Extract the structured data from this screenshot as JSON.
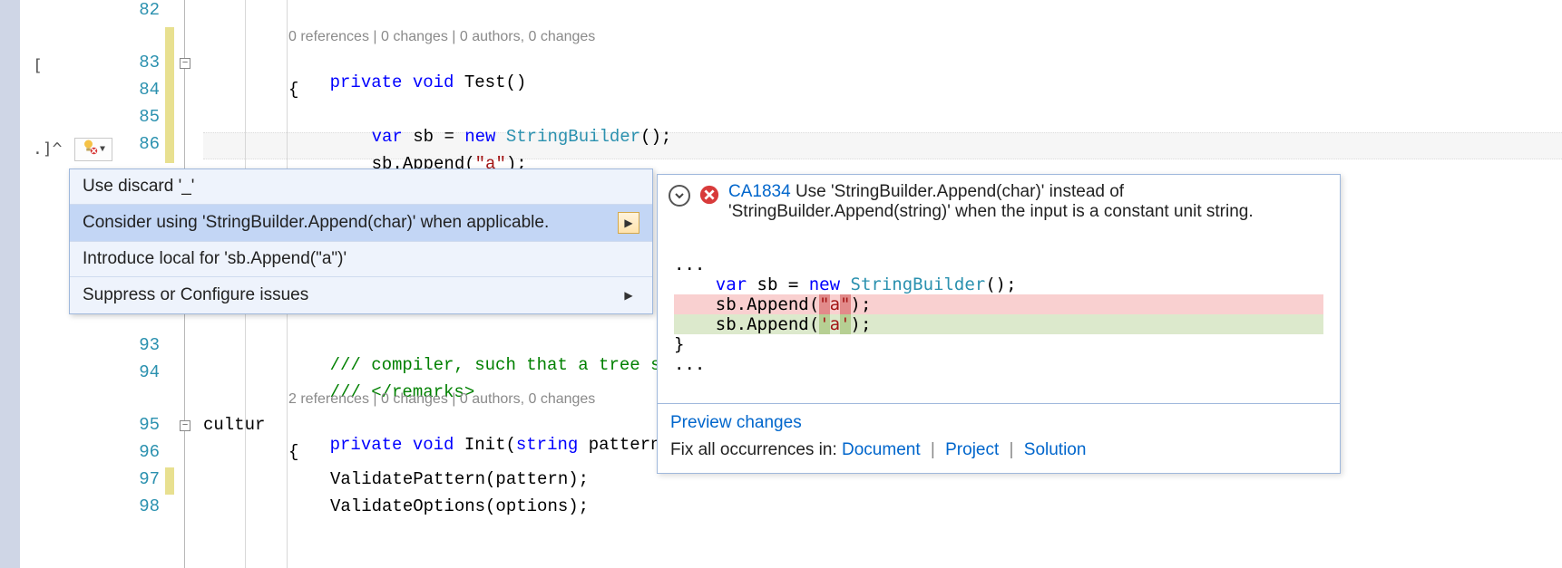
{
  "gutter": {
    "bracket_top": "[",
    "bracket_bottom": ".]^"
  },
  "line_numbers": [
    "82",
    "83",
    "84",
    "85",
    "86",
    "93",
    "94",
    "95",
    "96",
    "97",
    "98"
  ],
  "codelens1": "0 references | 0 changes | 0 authors, 0 changes",
  "codelens2": "2 references | 0 changes | 0 authors, 0 changes",
  "code": {
    "l83_a": "private",
    "l83_b": "void",
    "l83_c": "Test()",
    "l84": "{",
    "l85_a": "var",
    "l85_b": "sb = ",
    "l85_c": "new",
    "l85_d": "StringBuilder",
    "l85_e": "();",
    "l86_a": "sb.Append(",
    "l86_b": "\"a\"",
    "l86_c": ");",
    "l93_a": "/// ",
    "l93_b": "compiler, such that a tree s",
    "l94_a": "/// ",
    "l94_b": "</remarks>",
    "l95_a": "private",
    "l95_b": "void",
    "l95_c": "Init(",
    "l95_d": "string",
    "l95_e": " pattern",
    "l95_tail": "cultur",
    "l96": "{",
    "l97": "ValidatePattern(pattern);",
    "l98": "ValidateOptions(options);"
  },
  "menu": {
    "item1": "Use discard '_'",
    "item2": "Consider using 'StringBuilder.Append(char)' when applicable.",
    "item3": "Introduce local for 'sb.Append(\"a\")'",
    "item4": "Suppress or Configure issues"
  },
  "preview": {
    "rule_id": "CA1834",
    "rule_desc": "Use 'StringBuilder.Append(char)' instead of 'StringBuilder.Append(string)' when the input is a constant unit string.",
    "ellipsis": "...",
    "line_var_a": "var",
    "line_var_b": " sb = ",
    "line_var_c": "new",
    "line_var_d": " ",
    "line_var_e": "StringBuilder",
    "line_var_f": "();",
    "del_pre": "    sb.Append(",
    "del_quote": "\"",
    "del_mid": "a",
    "del_post": ");",
    "add_pre": "    sb.Append(",
    "add_quote": "'",
    "add_mid": "a",
    "add_post": ");",
    "brace": "}",
    "preview_link": "Preview changes",
    "fix_label": "Fix all occurrences in: ",
    "fix_doc": "Document",
    "fix_proj": "Project",
    "fix_sol": "Solution"
  }
}
